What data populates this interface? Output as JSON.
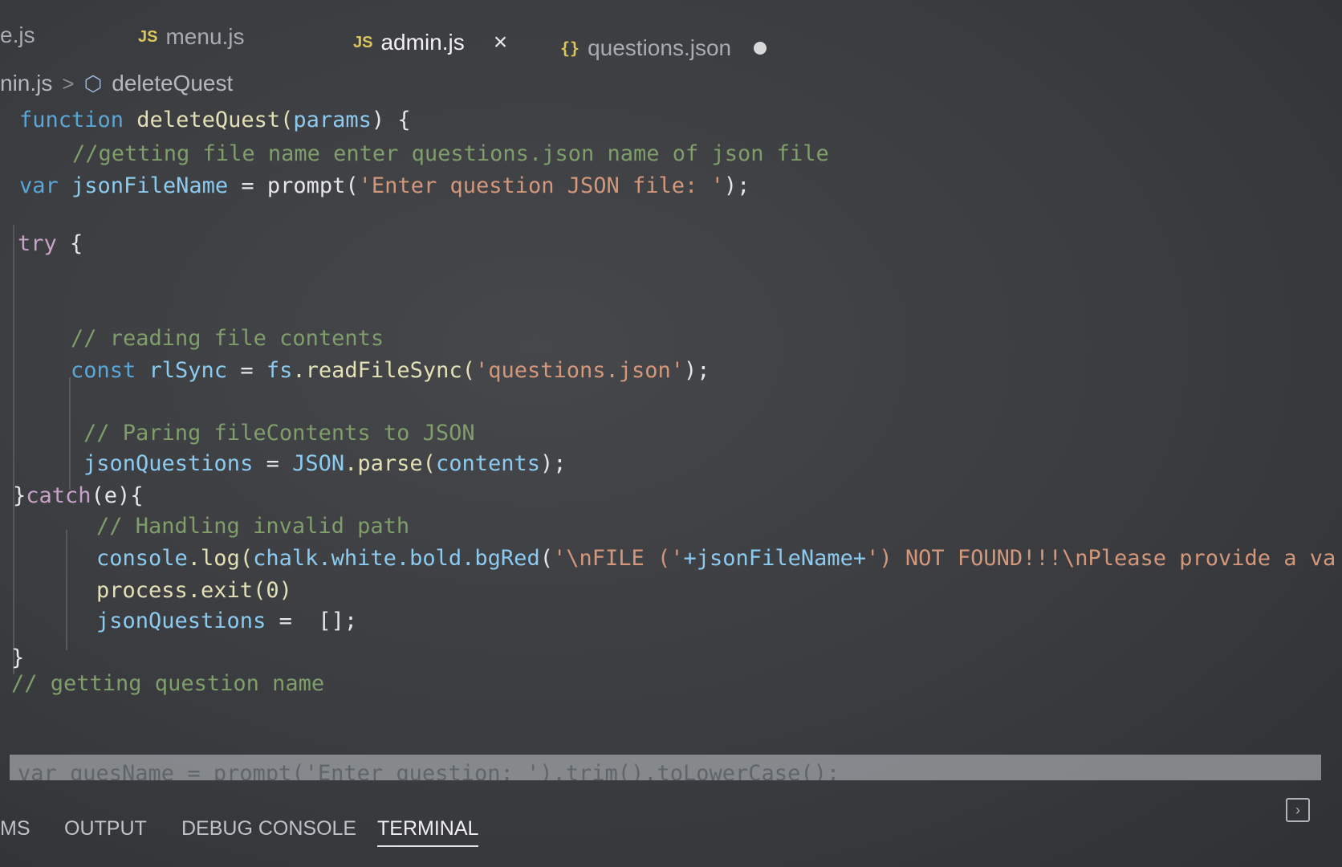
{
  "tabs": [
    {
      "label": "e.js",
      "icon": "js-file-icon"
    },
    {
      "label": "menu.js",
      "icon": "js-file-icon",
      "badge": "JS"
    },
    {
      "label": "admin.js",
      "icon": "js-file-icon",
      "badge": "JS",
      "active": true,
      "close": "×"
    },
    {
      "label": "questions.json",
      "icon": "json-file-icon",
      "badge": "{}",
      "modified": true
    }
  ],
  "breadcrumb": {
    "file": "nin.js",
    "separator": ">",
    "symbol": "deleteQuest"
  },
  "code": {
    "l1": {
      "kw": "function",
      "name": " deleteQuest(",
      "param": "params",
      "rest": ") {"
    },
    "l2": {
      "comment": "//getting file name enter questions.json name of json file"
    },
    "l3": {
      "kw": "var",
      "name": " jsonFileName",
      "eq": " = prompt(",
      "str": "'Enter question JSON file: '",
      "rest": ");"
    },
    "l4": {
      "kw": "try",
      "rest": " {"
    },
    "l5": {
      "comment": "// reading file contents"
    },
    "l6": {
      "kw": "const",
      "name": " rlSync",
      "eq": " = ",
      "obj": "fs",
      "call": ".readFileSync(",
      "str": "'questions.json'",
      "rest": ");"
    },
    "l7": {
      "comment": "// Paring fileContents to JSON"
    },
    "l8": {
      "name": "jsonQuestions",
      "eq": " = ",
      "obj": "JSON",
      "call": ".parse(",
      "arg": "contents",
      "rest": ");"
    },
    "l9": {
      "brace": "}",
      "kw": "catch",
      "rest": "(e){"
    },
    "l10": {
      "comment": "// Handling invalid path"
    },
    "l11": {
      "obj": "console",
      "call": ".log(",
      "arg": "chalk.white.bold.bgRed",
      "open": "(",
      "str": "'\\nFILE ('",
      "plus": "+jsonFileName+",
      "str2": "') NOT FOUND!!!\\nPlease provide a va"
    },
    "l12": {
      "text": "process.exit(0)"
    },
    "l13": {
      "name": "jsonQuestions",
      "eq": " =  ",
      "rest": "[];"
    },
    "l14": {
      "brace": "}"
    },
    "l15": {
      "comment": "// getting question name"
    },
    "l16": {
      "text": "var quesName = prompt('Enter question: ').trim().toLowerCase();"
    }
  },
  "panel": {
    "tabs": [
      "MS",
      "OUTPUT",
      "DEBUG CONSOLE",
      "TERMINAL"
    ],
    "active": "TERMINAL"
  },
  "colors": {
    "keyword": "#5aa6d6",
    "string": "#d4977a",
    "comment": "#7f9e6a",
    "variable": "#8ccbf0"
  }
}
